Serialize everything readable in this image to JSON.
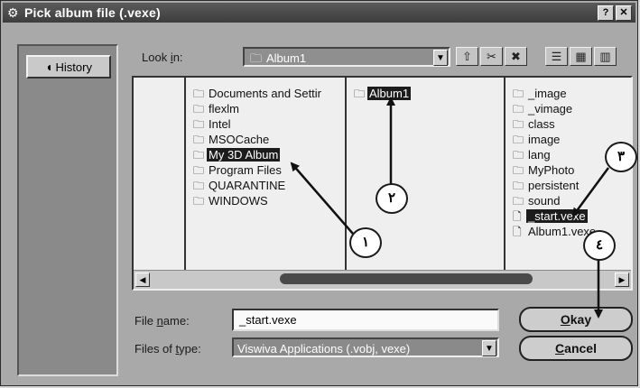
{
  "window": {
    "title": "Pick album file (.vexe)",
    "title_icon": "gear-icon",
    "help_btn": "?",
    "close_btn": "✕"
  },
  "sidebar": {
    "history_label": "History"
  },
  "lookin": {
    "label_pre": "Look ",
    "label_key": "i",
    "label_post": "n:",
    "value": "Album1"
  },
  "toolbar": {
    "icons": [
      "up-folder-icon",
      "cut-icon",
      "delete-icon",
      "list-view-icon",
      "details-view-icon",
      "thumbnail-view-icon"
    ]
  },
  "columns": [
    {
      "items": [
        {
          "label": "Documents and Settir",
          "selected": false
        },
        {
          "label": "flexlm",
          "selected": false
        },
        {
          "label": "Intel",
          "selected": false
        },
        {
          "label": "MSOCache",
          "selected": false
        },
        {
          "label": "My 3D Album",
          "selected": true
        },
        {
          "label": "Program Files",
          "selected": false
        },
        {
          "label": "QUARANTINE",
          "selected": false
        },
        {
          "label": "WINDOWS",
          "selected": false
        }
      ]
    },
    {
      "items": [
        {
          "label": "Album1",
          "selected": true
        }
      ]
    },
    {
      "items": [
        {
          "label": "_image",
          "selected": false
        },
        {
          "label": "_vimage",
          "selected": false
        },
        {
          "label": "class",
          "selected": false
        },
        {
          "label": "image",
          "selected": false
        },
        {
          "label": "lang",
          "selected": false
        },
        {
          "label": "MyPhoto",
          "selected": false
        },
        {
          "label": "persistent",
          "selected": false
        },
        {
          "label": "sound",
          "selected": false
        },
        {
          "label": "_start.vexe",
          "selected": true
        },
        {
          "label": "Album1.vexe",
          "selected": false
        }
      ]
    }
  ],
  "filename": {
    "label_pre": "File ",
    "label_key": "n",
    "label_post": "ame:",
    "value": "_start.vexe"
  },
  "filetype": {
    "label_pre": "Files of ",
    "label_key": "t",
    "label_post": "ype:",
    "value": "Viswiva Applications (.vobj, vexe)"
  },
  "buttons": {
    "okay_key": "O",
    "okay_rest": "kay",
    "cancel_key": "C",
    "cancel_rest": "ancel"
  },
  "callouts": [
    "١",
    "٢",
    "٣",
    "٤"
  ]
}
